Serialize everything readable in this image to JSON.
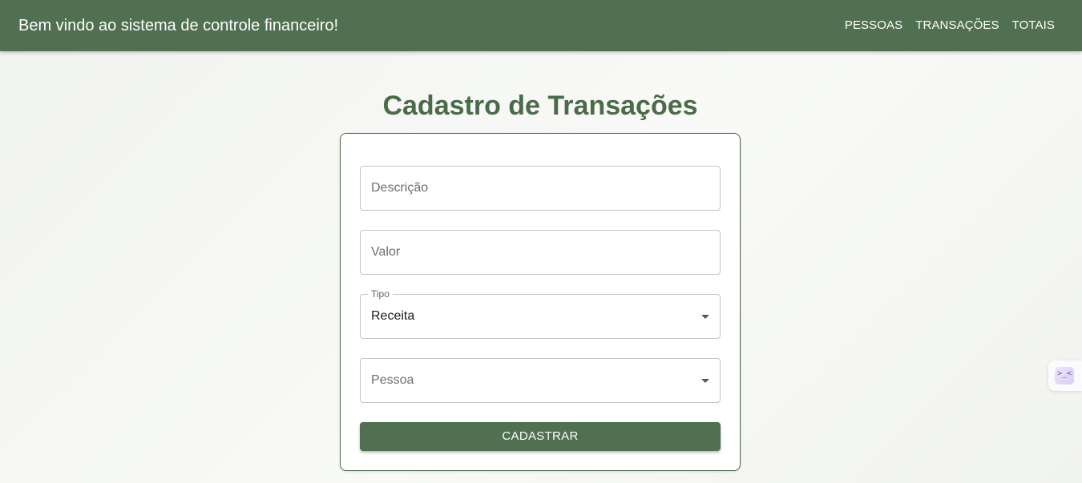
{
  "header": {
    "title": "Bem vindo ao sistema de controle financeiro!",
    "nav": [
      {
        "label": "PESSOAS"
      },
      {
        "label": "TRANSAÇÕES"
      },
      {
        "label": "TOTAIS"
      }
    ]
  },
  "page": {
    "title": "Cadastro de Transações"
  },
  "form": {
    "descricao": {
      "placeholder": "Descrição"
    },
    "valor": {
      "placeholder": "Valor"
    },
    "tipo": {
      "label": "Tipo",
      "value": "Receita"
    },
    "pessoa": {
      "placeholder": "Pessoa"
    },
    "submit_label": "CADASTRAR"
  },
  "extension": {
    "icon": "terminal-icon",
    "glyph": ">_<"
  },
  "colors": {
    "primary": "#516f51",
    "title": "#4a6b4a"
  }
}
